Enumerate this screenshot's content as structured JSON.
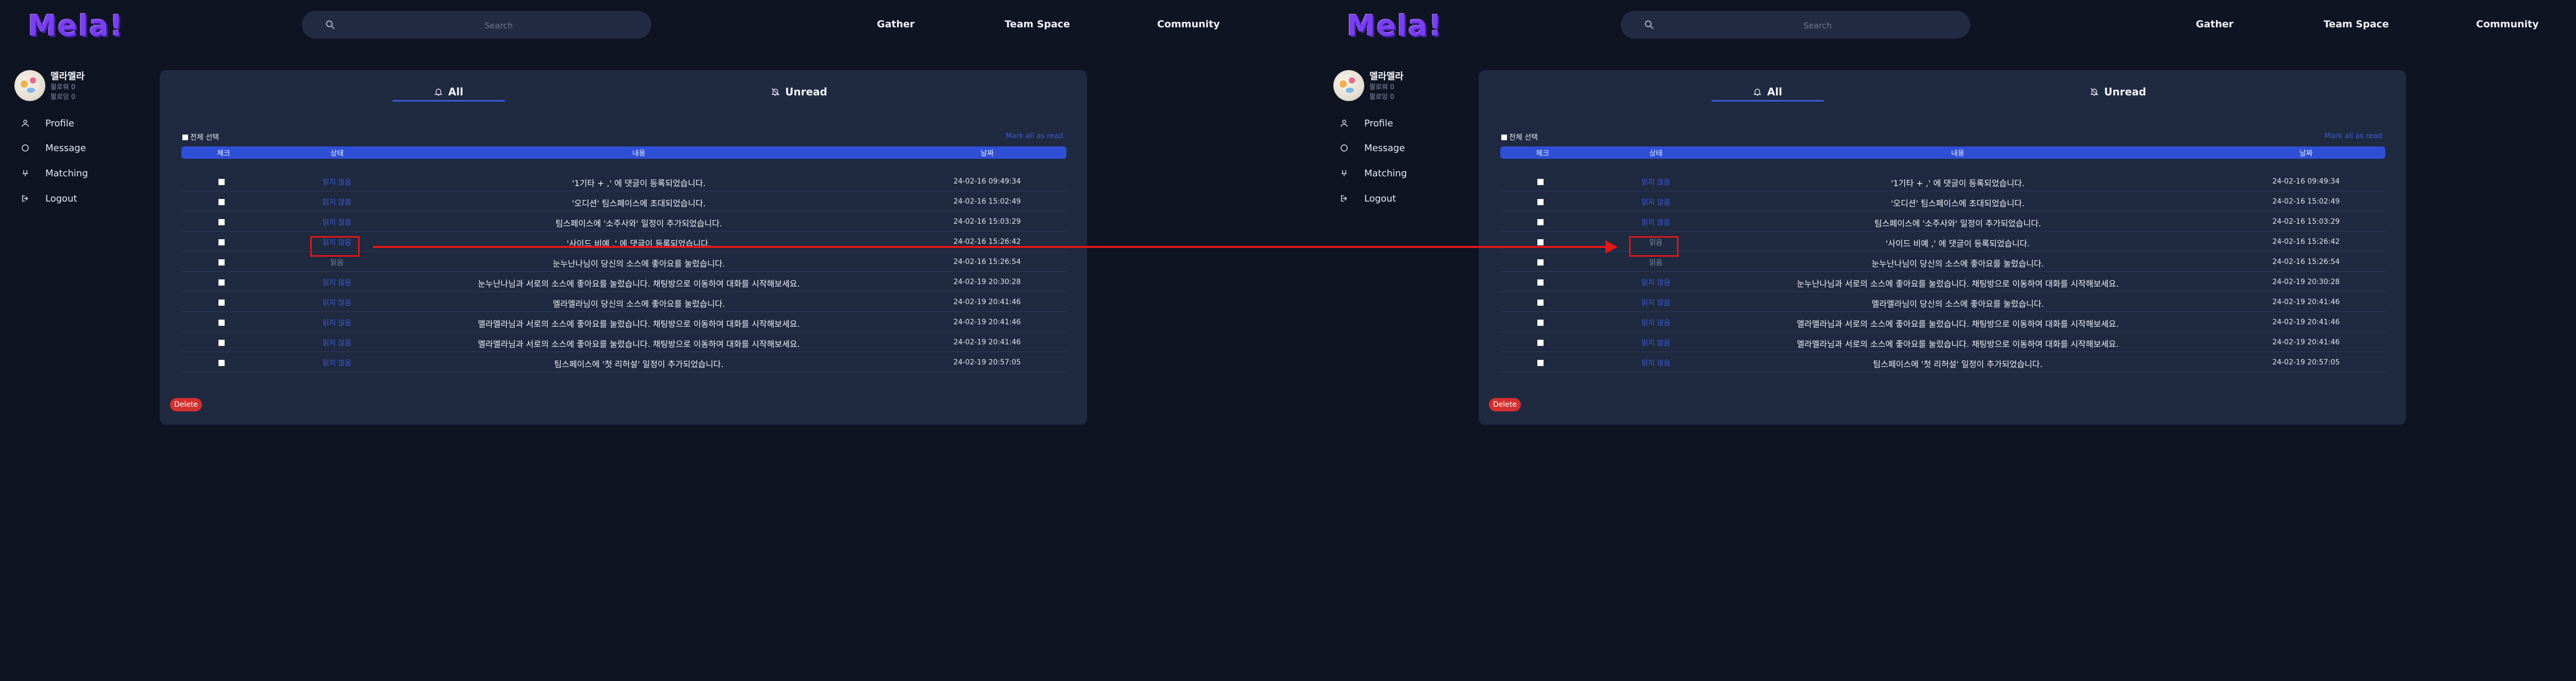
{
  "brand": {
    "logo_text": "Mela!",
    "logo_color": "#7b3ff2"
  },
  "search": {
    "placeholder": "Search"
  },
  "nav": {
    "gather": "Gather",
    "team_space": "Team Space",
    "community": "Community"
  },
  "user": {
    "name": "멜라멜라",
    "meta1": "팔로워 0",
    "meta2": "팔로잉 0"
  },
  "sidebar": {
    "items": [
      {
        "label": "Profile",
        "icon": "user-icon"
      },
      {
        "label": "Message",
        "icon": "chat-icon"
      },
      {
        "label": "Matching",
        "icon": "matching-icon"
      },
      {
        "label": "Logout",
        "icon": "logout-icon"
      }
    ]
  },
  "tabs": {
    "all": "All",
    "unread": "Unread"
  },
  "table": {
    "select_all": "전체 선택",
    "mark_all": "Mark all as read",
    "headers": {
      "check": "체크",
      "status": "상태",
      "content": "내용",
      "date": "날짜"
    },
    "status_labels": {
      "unread": "읽지 않음",
      "read": "읽음"
    },
    "rows": [
      {
        "content": "'1기타 + ,' 에 댓글이 등록되었습니다.",
        "date": "24-02-16 09:49:34"
      },
      {
        "content": "'오디션' 팀스페이스에 초대되었습니다.",
        "date": "24-02-16 15:02:49"
      },
      {
        "content": "팀스페이스에 '소주사와' 일정이 추가되었습니다.",
        "date": "24-02-16 15:03:29"
      },
      {
        "content": "'사이드 비예 ,' 에 댓글이 등록되었습니다.",
        "date": "24-02-16 15:26:42"
      },
      {
        "content": "눈누난나님이 당신의 소스에 좋아요를 눌렀습니다.",
        "date": "24-02-16 15:26:54"
      },
      {
        "content": "눈누난나님과 서로의 소스에 좋아요를 눌렀습니다. 채팅방으로 이동하여 대화를 시작해보세요.",
        "date": "24-02-19 20:30:28"
      },
      {
        "content": "멜라멜라님이 당신의 소스에 좋아요를 눌렀습니다.",
        "date": "24-02-19 20:41:46"
      },
      {
        "content": "멜라멜라님과 서로의 소스에 좋아요를 눌렀습니다. 채팅방으로 이동하여 대화를 시작해보세요.",
        "date": "24-02-19 20:41:46"
      },
      {
        "content": "멜라멜라님과 서로의 소스에 좋아요를 눌렀습니다. 채팅방으로 이동하여 대화를 시작해보세요.",
        "date": "24-02-19 20:41:46"
      },
      {
        "content": "팀스페이스에 '첫 리허설' 일정이 추가되었습니다.",
        "date": "24-02-19 20:57:05"
      }
    ],
    "read_flags_before": [
      false,
      false,
      false,
      false,
      true,
      false,
      false,
      false,
      false,
      false
    ],
    "read_flags_after": [
      false,
      false,
      false,
      true,
      true,
      false,
      false,
      false,
      false,
      false
    ]
  },
  "delete_label": "Delete",
  "colors": {
    "background": "#0f1422",
    "card": "#1f2940",
    "accent": "#3b5bdb",
    "danger": "#d32f2f",
    "annotation": "#e01717"
  }
}
